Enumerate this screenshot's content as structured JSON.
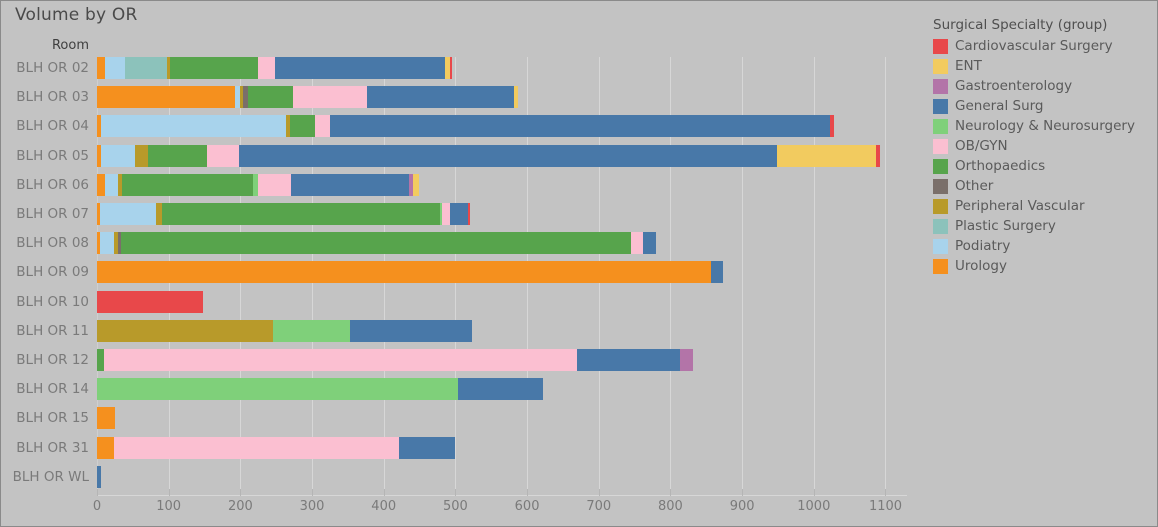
{
  "title": "Volume by OR",
  "axis": {
    "row_header": "Room",
    "x_ticks": [
      0,
      100,
      200,
      300,
      400,
      500,
      600,
      700,
      800,
      900,
      1000,
      1100
    ]
  },
  "legend": {
    "title": "Surgical Specialty (group)",
    "items": [
      {
        "label": "Cardiovascular Surgery",
        "color": "#e8484a"
      },
      {
        "label": "ENT",
        "color": "#f2cb5f"
      },
      {
        "label": "Gastroenterology",
        "color": "#b374a8"
      },
      {
        "label": "General Surg",
        "color": "#4878a8"
      },
      {
        "label": "Neurology & Neurosurgery",
        "color": "#7fd07a"
      },
      {
        "label": "OB/GYN",
        "color": "#fbbfd1"
      },
      {
        "label": "Orthopaedics",
        "color": "#57a44c"
      },
      {
        "label": "Other",
        "color": "#7a6f6a"
      },
      {
        "label": "Peripheral Vascular",
        "color": "#b89a2a"
      },
      {
        "label": "Plastic Surgery",
        "color": "#8cc2bb"
      },
      {
        "label": "Podiatry",
        "color": "#a8d3ec"
      },
      {
        "label": "Urology",
        "color": "#f5901e"
      }
    ]
  },
  "chart_data": {
    "type": "bar",
    "orientation": "horizontal",
    "stacked": true,
    "title": "Volume by OR",
    "xlabel": "",
    "ylabel": "Room",
    "xlim": [
      0,
      1130
    ],
    "grid": true,
    "legend_position": "right",
    "categories": [
      "BLH OR 02",
      "BLH OR 03",
      "BLH OR 04",
      "BLH OR 05",
      "BLH OR 06",
      "BLH OR 07",
      "BLH OR 08",
      "BLH OR 09",
      "BLH OR 10",
      "BLH OR 11",
      "BLH OR 12",
      "BLH OR 14",
      "BLH OR 15",
      "BLH OR 31",
      "BLH OR WL"
    ],
    "series": [
      {
        "name": "Cardiovascular Surgery",
        "color": "#e8484a",
        "values": [
          4,
          0,
          5,
          6,
          0,
          4,
          0,
          0,
          148,
          0,
          0,
          0,
          0,
          0,
          0
        ]
      },
      {
        "name": "ENT",
        "color": "#f2cb5f",
        "values": [
          7,
          6,
          0,
          138,
          8,
          0,
          0,
          0,
          0,
          0,
          0,
          0,
          0,
          0,
          0
        ]
      },
      {
        "name": "Gastroenterology",
        "color": "#b374a8",
        "values": [
          0,
          0,
          0,
          0,
          6,
          0,
          0,
          0,
          0,
          0,
          18,
          0,
          0,
          0,
          0
        ]
      },
      {
        "name": "General Surg",
        "color": "#4878a8",
        "values": [
          237,
          205,
          698,
          751,
          164,
          24,
          18,
          17,
          0,
          170,
          144,
          118,
          0,
          78,
          6
        ]
      },
      {
        "name": "Neurology & Neurosurgery",
        "color": "#7fd07a",
        "values": [
          0,
          0,
          0,
          0,
          7,
          4,
          0,
          0,
          0,
          107,
          0,
          504,
          0,
          0,
          0
        ]
      },
      {
        "name": "OB/GYN",
        "color": "#fbbfd1",
        "values": [
          23,
          103,
          21,
          45,
          47,
          11,
          17,
          0,
          0,
          0,
          660,
          0,
          0,
          398,
          0
        ]
      },
      {
        "name": "Orthopaedics",
        "color": "#57a44c",
        "values": [
          123,
          64,
          35,
          82,
          182,
          387,
          711,
          0,
          0,
          0,
          10,
          0,
          0,
          0,
          0
        ]
      },
      {
        "name": "Other",
        "color": "#7a6f6a",
        "values": [
          0,
          7,
          0,
          0,
          0,
          0,
          4,
          0,
          0,
          0,
          0,
          0,
          0,
          0,
          0
        ]
      },
      {
        "name": "Peripheral Vascular",
        "color": "#b89a2a",
        "values": [
          4,
          4,
          6,
          18,
          6,
          8,
          6,
          0,
          0,
          246,
          0,
          0,
          0,
          0,
          0
        ]
      },
      {
        "name": "Plastic Surgery",
        "color": "#8cc2bb",
        "values": [
          59,
          0,
          0,
          0,
          0,
          0,
          0,
          0,
          0,
          0,
          0,
          0,
          0,
          0,
          0
        ]
      },
      {
        "name": "Podiatry",
        "color": "#a8d3ec",
        "values": [
          28,
          7,
          257,
          47,
          18,
          79,
          20,
          0,
          0,
          0,
          0,
          0,
          0,
          0,
          0
        ]
      },
      {
        "name": "Urology",
        "color": "#f5901e",
        "values": [
          11,
          192,
          6,
          6,
          11,
          4,
          4,
          857,
          0,
          0,
          0,
          0,
          25,
          24,
          0
        ]
      }
    ],
    "stack_order": [
      "Urology",
      "Podiatry",
      "Plastic Surgery",
      "Peripheral Vascular",
      "Other",
      "Orthopaedics",
      "Neurology & Neurosurgery",
      "OB/GYN",
      "General Surg",
      "Gastroenterology",
      "ENT",
      "Cardiovascular Surgery"
    ],
    "row_totals": [
      496,
      588,
      1028,
      1093,
      449,
      521,
      780,
      874,
      148,
      523,
      832,
      622,
      25,
      500,
      6
    ]
  }
}
